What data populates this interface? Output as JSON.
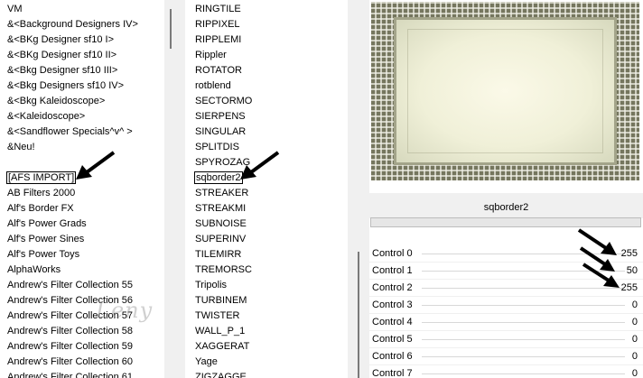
{
  "left_list_top": [
    "VM",
    "&<Background Designers IV>",
    "&<BKg Designer sf10 I>",
    "&<BKg Designer sf10 II>",
    "&<Bkg Designer sf10 III>",
    "&<Bkg Designers sf10 IV>",
    "&<Bkg Kaleidoscope>",
    "&<Kaleidoscope>",
    "&<Sandflower Specials^v^ >",
    "&Neu!"
  ],
  "left_list_bottom": [
    "[AFS IMPORT]",
    "AB Filters 2000",
    "Alf's Border FX",
    "Alf's Power Grads",
    "Alf's Power Sines",
    "Alf's Power Toys",
    "AlphaWorks",
    "Andrew's Filter Collection 55",
    "Andrew's Filter Collection 56",
    "Andrew's Filter Collection 57",
    "Andrew's Filter Collection 58",
    "Andrew's Filter Collection 59",
    "Andrew's Filter Collection 60",
    "Andrew's Filter Collection 61"
  ],
  "middle_list": [
    "RINGTILE",
    "RIPPIXEL",
    "RIPPLEMI",
    "Rippler",
    "ROTATOR",
    "rotblend",
    "SECTORMO",
    "SIERPENS",
    "SINGULAR",
    "SPLITDIS",
    "SPYROZAG",
    "sqborder2",
    "STREAKER",
    "STREAKMI",
    "SUBNOISE",
    "SUPERINV",
    "TILEMIRR",
    "TREMORSC",
    "Tripolis",
    "TURBINEM",
    "TWISTER",
    "WALL_P_1",
    "XAGGERAT",
    "Yage",
    "ZIGZAGGE"
  ],
  "selected_left": "[AFS IMPORT]",
  "selected_middle": "sqborder2",
  "filter_name": "sqborder2",
  "controls": [
    {
      "label": "Control 0",
      "value": "255"
    },
    {
      "label": "Control 1",
      "value": "50"
    },
    {
      "label": "Control 2",
      "value": "255"
    },
    {
      "label": "Control 3",
      "value": "0"
    },
    {
      "label": "Control 4",
      "value": "0"
    },
    {
      "label": "Control 5",
      "value": "0"
    },
    {
      "label": "Control 6",
      "value": "0"
    },
    {
      "label": "Control 7",
      "value": "0"
    }
  ],
  "watermark": "Leny",
  "colors": {
    "panel_bg": "#ffffff",
    "separator_bg": "#f0f0f0",
    "preview_border": "#75765e",
    "preview_center": "#fbf9e8",
    "arrow": "#000000"
  },
  "icons": [
    "pointer-arrow-icon"
  ]
}
